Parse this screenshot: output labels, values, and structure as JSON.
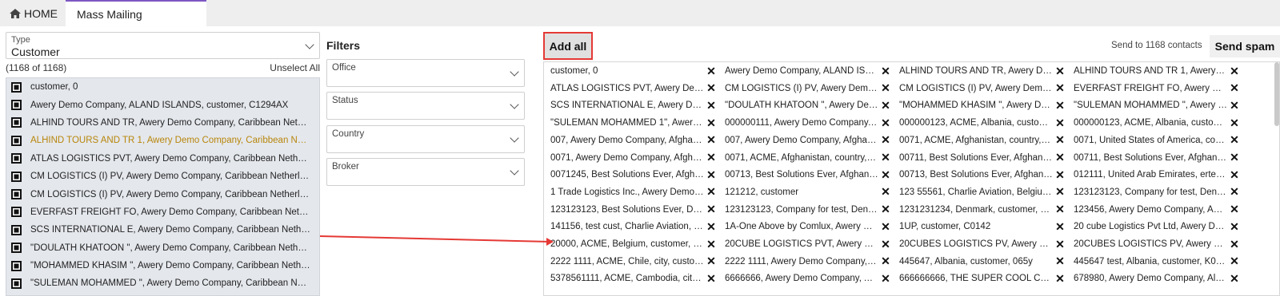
{
  "tabs": {
    "home_label": "HOME",
    "active_label": "Mass Mailing"
  },
  "left": {
    "type_label": "Type",
    "type_value": "Customer",
    "count_text": "(1168 of 1168)",
    "unselect_label": "Unselect All",
    "items": [
      "customer, 0",
      "Awery Demo Company, ALAND ISLANDS, customer, C1294AX",
      "ALHIND TOURS AND TR, Awery Demo Company, Caribbean Netherla...",
      "ALHIND TOURS AND TR 1, Awery Demo Company, Caribbean Netherl...",
      "ATLAS LOGISTICS PVT, Awery Demo Company, Caribbean Netherlan...",
      "CM LOGISTICS (I) PV, Awery Demo Company, Caribbean Netherlands...",
      "CM LOGISTICS (I) PV, Awery Demo Company, Caribbean Netherlands...",
      "EVERFAST FREIGHT FO, Awery Demo Company, Caribbean Netherlan...",
      "SCS INTERNATIONAL E, Awery Demo Company, Caribbean Netherla...",
      "\"DOULATH KHATOON \", Awery Demo Company, Caribbean Netherlan...",
      "\"MOHAMMED KHASIM \", Awery Demo Company, Caribbean Netherla...",
      "\"SULEMAN MOHAMMED \", Awery Demo Company, Caribbean Nether..."
    ],
    "highlight_index": 3
  },
  "filters": {
    "title": "Filters",
    "items": [
      "Office",
      "Status",
      "Country",
      "Broker"
    ]
  },
  "right": {
    "add_all_label": "Add all",
    "send_to_text": "Send to 1168 contacts",
    "send_spam_label": "Send spam",
    "remove_symbol": "✕",
    "rows": [
      [
        "customer, 0",
        "Awery Demo Company, ALAND ISLAN...",
        "ALHIND TOURS AND TR, Awery Demo...",
        "ALHIND TOURS AND TR 1, Awery De..."
      ],
      [
        "ATLAS LOGISTICS PVT, Awery Demo ...",
        "CM LOGISTICS (I) PV, Awery Demo Co...",
        "CM LOGISTICS (I) PV, Awery Demo Co...",
        "EVERFAST FREIGHT FO, Awery Demo ..."
      ],
      [
        "SCS INTERNATIONAL E, Awery Demo ...",
        "\"DOULATH KHATOON \", Awery Demo ...",
        "\"MOHAMMED KHASIM \", Awery Demo ...",
        "\"SULEMAN MOHAMMED \", Awery De..."
      ],
      [
        "\"SULEMAN MOHAMMED 1\", Awery De...",
        "000000111, Awery Demo Company, c...",
        "000000123, ACME, Albania, customer, 0",
        "000000123, ACME, Albania, customer,..."
      ],
      [
        "007, Awery Demo Company, Afghanist...",
        "007, Awery Demo Company, Afghanist...",
        "0071, ACME, Afghanistan, country, cu...",
        "0071, United States of America, count..."
      ],
      [
        "0071, Awery Demo Company, Afghani...",
        "0071, ACME, Afghanistan, country, cu...",
        "00711, Best Solutions Ever, Afghanist...",
        "00711, Best Solutions Ever, Afghanist..."
      ],
      [
        "0071245, Best Solutions Ever, Afghani...",
        "00713, Best Solutions Ever, Afghanist...",
        "00713, Best Solutions Ever, Afghanist...",
        "012111, United Arab Emirates, erterer..."
      ],
      [
        "1 Trade Logistics Inc., Awery Demo C...",
        "121212, customer",
        "123 55561, Charlie Aviation, Belgium, ...",
        "123123123, Company for test, Denma..."
      ],
      [
        "123123123, Best Solutions Ever, Den...",
        "123123123, Company for test, Denma...",
        "1231231234, Denmark, customer, C12...",
        "123456, Awery Demo Company, Amer..."
      ],
      [
        "141156, test cust, Charlie Aviation, Ki...",
        "1A-One Above by Comlux, Awery Dem...",
        "1UP, customer, C0142",
        "20 cube Logistics Pvt Ltd, Awery Dem..."
      ],
      [
        "20000, ACME, Belgium, customer, K00...",
        "20CUBE LOGISTICS PVT, Awery Demo...",
        "20CUBES LOGISTICS PV, Awery Demo...",
        "20CUBES LOGISTICS PV, Awery Demo..."
      ],
      [
        "2222 1111, ACME, Chile, city, custome...",
        "2222 1111, Awery Demo Company, Ch...",
        "445647, Albania, customer, 065y",
        "445647 test, Albania, customer, K004AL"
      ],
      [
        "5378561111, ACME, Cambodia, city t...",
        "6666666, Awery Demo Company, Afg...",
        "666666666, THE SUPER COOL COMP...",
        "678980, Awery Demo Company, Alban..."
      ]
    ]
  },
  "colors": {
    "annotation": "#e53935",
    "highlight_text": "#b8860b"
  }
}
